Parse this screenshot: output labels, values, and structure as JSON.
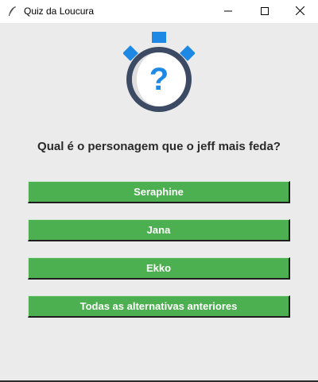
{
  "window": {
    "title": "Quiz da Loucura",
    "controls": {
      "minimize": "minimize-icon",
      "maximize": "maximize-icon",
      "close": "close-icon"
    }
  },
  "quiz": {
    "icon": "stopwatch-question-icon",
    "question": "Qual é o personagem que o jeff mais feda?",
    "answers": [
      "Seraphine",
      "Jana",
      "Ekko",
      "Todas as alternativas anteriores"
    ]
  },
  "colors": {
    "button_green": "#4caf50",
    "button_text": "#ffffff",
    "background": "#ebebeb",
    "icon_blue": "#1e88e5",
    "icon_dark": "#3c4a63"
  }
}
